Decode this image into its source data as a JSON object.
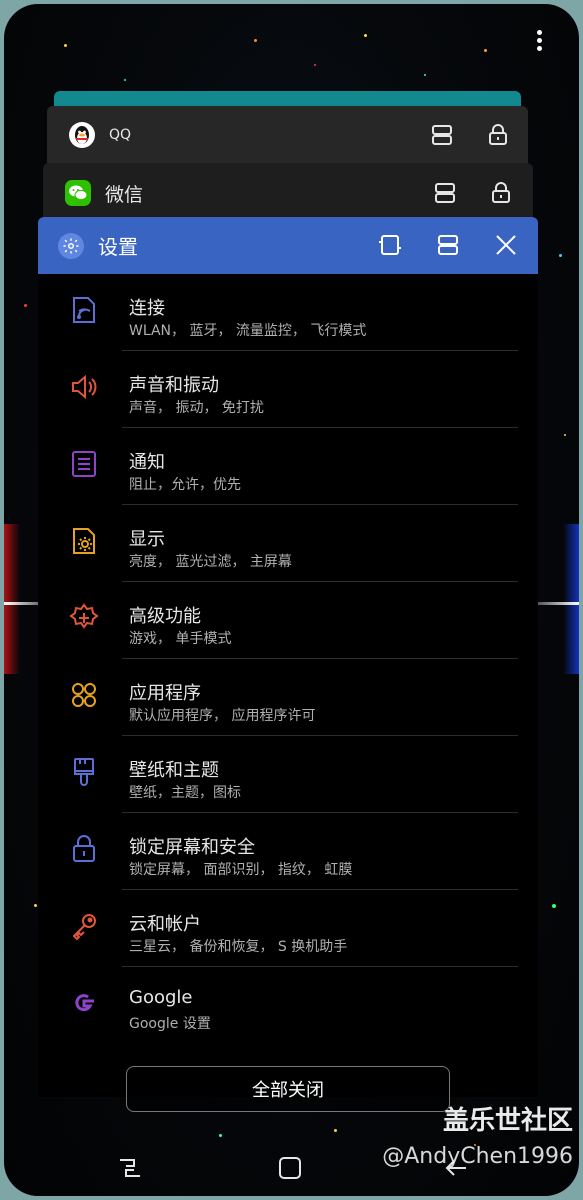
{
  "recents": {
    "cards": [
      {
        "name": "QQ"
      },
      {
        "name": "微信"
      },
      {
        "name": "设置"
      }
    ]
  },
  "settings_list": [
    {
      "title": "连接",
      "subtitle": "WLAN， 蓝牙， 流量监控， 飞行模式",
      "icon": "wifi-connect-icon",
      "color": "#5c6fd6"
    },
    {
      "title": "声音和振动",
      "subtitle": "声音， 振动， 免打扰",
      "icon": "speaker-icon",
      "color": "#e0563a"
    },
    {
      "title": "通知",
      "subtitle": "阻止，允许，优先",
      "icon": "notification-list-icon",
      "color": "#8e44c9"
    },
    {
      "title": "显示",
      "subtitle": "亮度， 蓝光过滤， 主屏幕",
      "icon": "display-brightness-icon",
      "color": "#e6a21e"
    },
    {
      "title": "高级功能",
      "subtitle": "游戏， 单手模式",
      "icon": "advanced-gear-icon",
      "color": "#e0563a"
    },
    {
      "title": "应用程序",
      "subtitle": "默认应用程序， 应用程序许可",
      "icon": "apps-grid-icon",
      "color": "#e6a21e"
    },
    {
      "title": "壁纸和主题",
      "subtitle": "壁纸，主题，图标",
      "icon": "paintbrush-icon",
      "color": "#5c6fd6"
    },
    {
      "title": "锁定屏幕和安全",
      "subtitle": "锁定屏幕， 面部识别， 指纹， 虹膜",
      "icon": "lock-icon",
      "color": "#5c6fd6"
    },
    {
      "title": "云和帐户",
      "subtitle": "三星云， 备份和恢复， S 换机助手",
      "icon": "key-icon",
      "color": "#e0563a"
    },
    {
      "title": "Google",
      "subtitle": "Google 设置",
      "icon": "google-icon",
      "color": "#8e44c9"
    }
  ],
  "close_all_label": "全部关闭",
  "watermark": {
    "line1": "盖乐世社区",
    "line2": "@AndyChen1996"
  },
  "colors": {
    "settings_bar": "#3a64c1",
    "wechat": "#2dc100"
  }
}
